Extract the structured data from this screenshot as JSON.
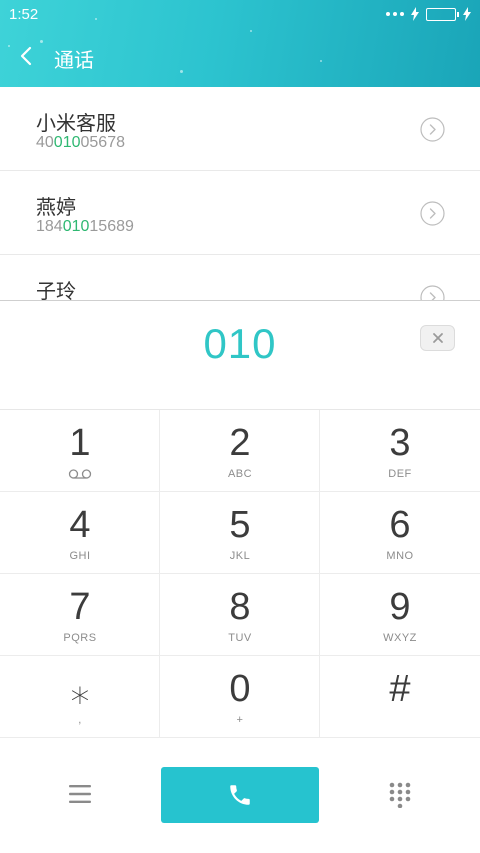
{
  "status": {
    "time": "1:52"
  },
  "header": {
    "title": "通话"
  },
  "contacts": [
    {
      "name": "小米客服",
      "number_pre": "40",
      "number_match": "010",
      "number_post": "05678"
    },
    {
      "name": "燕婷",
      "number_pre": "184",
      "number_match": "010",
      "number_post": "15689"
    },
    {
      "name": "子玲"
    }
  ],
  "dialed_number": "010",
  "keypad": [
    {
      "digit": "1",
      "letters": "",
      "icon": "voicemail-icon"
    },
    {
      "digit": "2",
      "letters": "ABC"
    },
    {
      "digit": "3",
      "letters": "DEF"
    },
    {
      "digit": "4",
      "letters": "GHI"
    },
    {
      "digit": "5",
      "letters": "JKL"
    },
    {
      "digit": "6",
      "letters": "MNO"
    },
    {
      "digit": "7",
      "letters": "PQRS"
    },
    {
      "digit": "8",
      "letters": "TUV"
    },
    {
      "digit": "9",
      "letters": "WXYZ"
    },
    {
      "digit": "⁎",
      "letters": ","
    },
    {
      "digit": "0",
      "letters": "+"
    },
    {
      "digit": "#",
      "letters": ""
    }
  ],
  "colors": {
    "accent": "#26c3cf",
    "match_highlight": "#2fb872",
    "dialed_text": "#30c6c6"
  },
  "icons": {
    "back": "chevron-left-icon",
    "detail": "chevron-right-circle-icon",
    "delete": "backspace-icon",
    "menu": "menu-icon",
    "call": "phone-icon",
    "dialpad": "dialpad-icon"
  }
}
